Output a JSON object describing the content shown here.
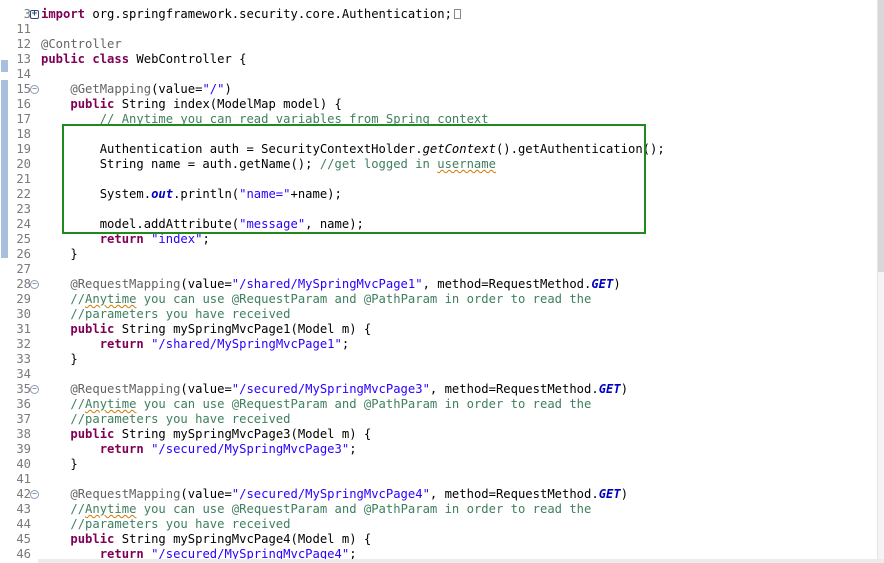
{
  "editor": {
    "lines": [
      {
        "n": "3",
        "fold": "plus",
        "segs": [
          {
            "c": "kw",
            "t": "import"
          },
          {
            "t": " org.springframework.security.core.Authentication;"
          }
        ],
        "ellipsis": true
      },
      {
        "n": "11",
        "segs": []
      },
      {
        "n": "12",
        "segs": [
          {
            "c": "ann",
            "t": "@Controller"
          }
        ]
      },
      {
        "n": "13",
        "segs": [
          {
            "c": "kw",
            "t": "public"
          },
          {
            "t": " "
          },
          {
            "c": "kw",
            "t": "class"
          },
          {
            "t": " WebController {"
          }
        ]
      },
      {
        "n": "14",
        "segs": []
      },
      {
        "n": "15",
        "fold": "minus",
        "segs": [
          {
            "t": "    "
          },
          {
            "c": "ann",
            "t": "@GetMapping"
          },
          {
            "t": "(value="
          },
          {
            "c": "str",
            "t": "\"/\""
          },
          {
            "t": ")"
          }
        ]
      },
      {
        "n": "16",
        "segs": [
          {
            "t": "    "
          },
          {
            "c": "kw",
            "t": "public"
          },
          {
            "t": " String index(ModelMap model) {"
          }
        ]
      },
      {
        "n": "17",
        "segs": [
          {
            "t": "        "
          },
          {
            "c": "cmt",
            "t": "// Anytime you can read variables from Spring context"
          }
        ]
      },
      {
        "n": "18",
        "segs": []
      },
      {
        "n": "19",
        "segs": [
          {
            "t": "        Authentication auth = SecurityContextHolder."
          },
          {
            "c": "it",
            "t": "getContext"
          },
          {
            "t": "().getAuthentication();"
          }
        ]
      },
      {
        "n": "20",
        "segs": [
          {
            "t": "        String name = auth.getName(); "
          },
          {
            "c": "cmt",
            "t": "//get logged in "
          },
          {
            "c": "cmt u",
            "t": "username"
          }
        ]
      },
      {
        "n": "21",
        "segs": []
      },
      {
        "n": "22",
        "segs": [
          {
            "t": "        System."
          },
          {
            "c": "st",
            "t": "out"
          },
          {
            "t": ".println("
          },
          {
            "c": "str",
            "t": "\"name=\""
          },
          {
            "t": "+name);"
          }
        ]
      },
      {
        "n": "23",
        "segs": []
      },
      {
        "n": "24",
        "segs": [
          {
            "t": "        model.addAttribute("
          },
          {
            "c": "str",
            "t": "\"message\""
          },
          {
            "t": ", name);"
          }
        ]
      },
      {
        "n": "25",
        "segs": [
          {
            "t": "        "
          },
          {
            "c": "kw",
            "t": "return"
          },
          {
            "t": " "
          },
          {
            "c": "str",
            "t": "\"index\""
          },
          {
            "t": ";"
          }
        ]
      },
      {
        "n": "26",
        "segs": [
          {
            "t": "    }"
          }
        ]
      },
      {
        "n": "27",
        "segs": []
      },
      {
        "n": "28",
        "fold": "minus",
        "segs": [
          {
            "t": "    "
          },
          {
            "c": "ann",
            "t": "@RequestMapping"
          },
          {
            "t": "(value="
          },
          {
            "c": "str",
            "t": "\"/shared/MySpringMvcPage1\""
          },
          {
            "t": ", method=RequestMethod."
          },
          {
            "c": "st",
            "t": "GET"
          },
          {
            "t": ")"
          }
        ]
      },
      {
        "n": "29",
        "segs": [
          {
            "t": "    "
          },
          {
            "c": "cmt",
            "t": "//"
          },
          {
            "c": "cmt u",
            "t": "Anytime"
          },
          {
            "c": "cmt",
            "t": " you can use @RequestParam and @PathParam in order to read the"
          }
        ]
      },
      {
        "n": "30",
        "segs": [
          {
            "t": "    "
          },
          {
            "c": "cmt",
            "t": "//parameters you have received"
          }
        ]
      },
      {
        "n": "31",
        "segs": [
          {
            "t": "    "
          },
          {
            "c": "kw",
            "t": "public"
          },
          {
            "t": " String mySpringMvcPage1(Model m) {"
          }
        ]
      },
      {
        "n": "32",
        "segs": [
          {
            "t": "        "
          },
          {
            "c": "kw",
            "t": "return"
          },
          {
            "t": " "
          },
          {
            "c": "str",
            "t": "\"/shared/MySpringMvcPage1\""
          },
          {
            "t": ";"
          }
        ]
      },
      {
        "n": "33",
        "segs": [
          {
            "t": "    }"
          }
        ]
      },
      {
        "n": "34",
        "segs": []
      },
      {
        "n": "35",
        "fold": "minus",
        "segs": [
          {
            "t": "    "
          },
          {
            "c": "ann",
            "t": "@RequestMapping"
          },
          {
            "t": "(value="
          },
          {
            "c": "str",
            "t": "\"/secured/MySpringMvcPage3\""
          },
          {
            "t": ", method=RequestMethod."
          },
          {
            "c": "st",
            "t": "GET"
          },
          {
            "t": ")"
          }
        ]
      },
      {
        "n": "36",
        "segs": [
          {
            "t": "    "
          },
          {
            "c": "cmt",
            "t": "//"
          },
          {
            "c": "cmt u",
            "t": "Anytime"
          },
          {
            "c": "cmt",
            "t": " you can use @RequestParam and @PathParam in order to read the"
          }
        ]
      },
      {
        "n": "37",
        "segs": [
          {
            "t": "    "
          },
          {
            "c": "cmt",
            "t": "//parameters you have received"
          }
        ]
      },
      {
        "n": "38",
        "segs": [
          {
            "t": "    "
          },
          {
            "c": "kw",
            "t": "public"
          },
          {
            "t": " String mySpringMvcPage3(Model m) {"
          }
        ]
      },
      {
        "n": "39",
        "segs": [
          {
            "t": "        "
          },
          {
            "c": "kw",
            "t": "return"
          },
          {
            "t": " "
          },
          {
            "c": "str",
            "t": "\"/secured/MySpringMvcPage3\""
          },
          {
            "t": ";"
          }
        ]
      },
      {
        "n": "40",
        "segs": [
          {
            "t": "    }"
          }
        ]
      },
      {
        "n": "41",
        "segs": []
      },
      {
        "n": "42",
        "fold": "minus",
        "segs": [
          {
            "t": "    "
          },
          {
            "c": "ann",
            "t": "@RequestMapping"
          },
          {
            "t": "(value="
          },
          {
            "c": "str",
            "t": "\"/secured/MySpringMvcPage4\""
          },
          {
            "t": ", method=RequestMethod."
          },
          {
            "c": "st",
            "t": "GET"
          },
          {
            "t": ")"
          }
        ]
      },
      {
        "n": "43",
        "segs": [
          {
            "t": "    "
          },
          {
            "c": "cmt",
            "t": "//"
          },
          {
            "c": "cmt u",
            "t": "Anytime"
          },
          {
            "c": "cmt",
            "t": " you can use @RequestParam and @PathParam in order to read the"
          }
        ]
      },
      {
        "n": "44",
        "segs": [
          {
            "t": "    "
          },
          {
            "c": "cmt",
            "t": "//parameters you have received"
          }
        ]
      },
      {
        "n": "45",
        "segs": [
          {
            "t": "    "
          },
          {
            "c": "kw",
            "t": "public"
          },
          {
            "t": " String mySpringMvcPage4(Model m) {"
          }
        ]
      },
      {
        "n": "46",
        "segs": [
          {
            "t": "        "
          },
          {
            "c": "kw",
            "t": "return"
          },
          {
            "t": " "
          },
          {
            "c": "str",
            "t": "\"/secured/MySpringMvcPage4\""
          },
          {
            "t": ";"
          }
        ]
      }
    ]
  },
  "colors": {
    "keyword": "#7f0055",
    "annotation": "#646464",
    "string": "#2a00ff",
    "comment": "#3f7f5f",
    "static_field": "#0000c0",
    "highlight_box": "#1f8b1f"
  }
}
